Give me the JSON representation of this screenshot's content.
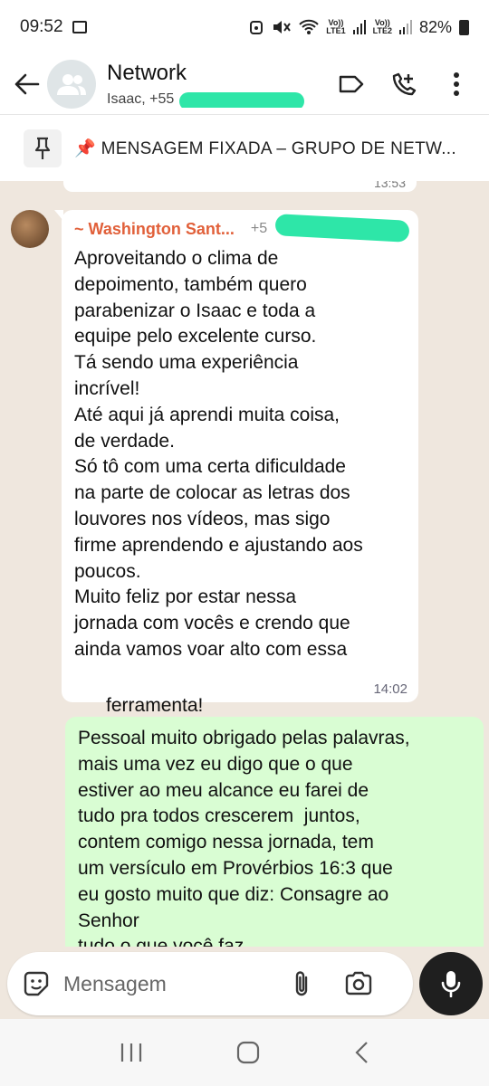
{
  "status_bar": {
    "time": "09:52",
    "net1_top": "Vo))",
    "net1_bottom": "LTE1",
    "net2_top": "Vo))",
    "net2_bottom": "LTE2",
    "battery": "82%"
  },
  "header": {
    "title": "Network",
    "subtitle": "Isaac, +55",
    "subtitle_tail": "..."
  },
  "pinned": {
    "emoji": "📌",
    "text": "MENSAGEM FIXADA – GRUPO DE NETW..."
  },
  "previous_message": {
    "time": "13:53"
  },
  "incoming_message": {
    "sender": "~ Washington Sant...",
    "phone": "+5",
    "text": "Aproveitando o clima de\ndepoimento, também quero\nparabenizar o Isaac e toda a\nequipe pelo excelente curso.\nTá sendo uma experiência\nincrível!\nAté aqui já aprendi muita coisa,\nde verdade.\nSó tô com uma certa dificuldade\nna parte de colocar as letras dos\nlouvores nos vídeos, mas sigo\nfirme aprendendo e ajustando aos\npoucos.\nMuito feliz por estar nessa\njornada com vocês e crendo que\nainda vamos voar alto com essa",
    "last_line": "ferramenta!",
    "time": "14:02"
  },
  "outgoing_message": {
    "text": "Pessoal muito obrigado pelas palavras,\nmais uma vez eu digo que o que\nestiver ao meu alcance eu farei de\ntudo pra todos crescerem  juntos,\ncontem comigo nessa jornada, tem\num versículo em Provérbios 16:3 que\neu gosto muito que diz: Consagre ao\nSenhor\ntudo o que você faz"
  },
  "input": {
    "placeholder": "Mensagem"
  },
  "icons": {
    "back": "back-arrow-icon",
    "label": "label-icon",
    "add_call": "add-call-icon",
    "menu": "more-vert-icon",
    "pin": "pin-icon",
    "emoji": "emoji-icon",
    "attach": "paperclip-icon",
    "camera": "camera-icon",
    "mic": "mic-icon"
  },
  "colors": {
    "sender": "#e1603a",
    "outgoing_bubble": "#d9fdd3",
    "redaction": "#2ee6a8"
  }
}
